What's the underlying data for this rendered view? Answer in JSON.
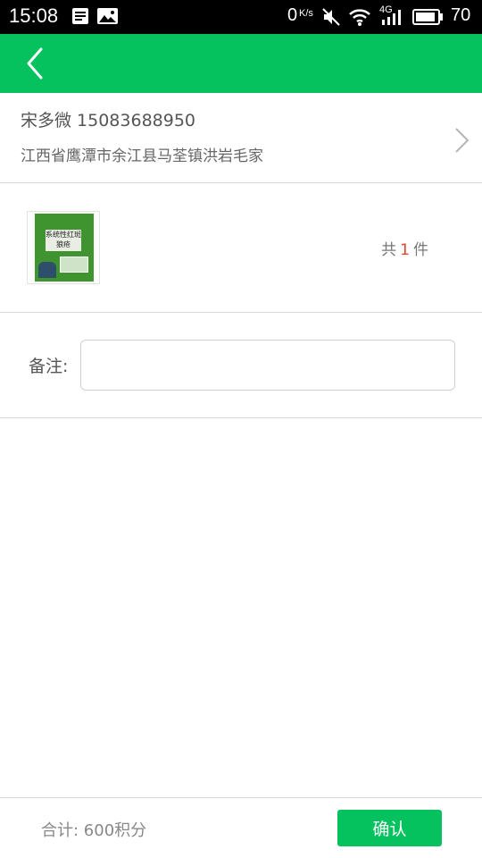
{
  "status_bar": {
    "time": "15:08",
    "net_speed": "0",
    "net_unit": "K/s",
    "network_type": "4G",
    "battery": "70",
    "icons": [
      "notification-icon",
      "gallery-icon",
      "mute-icon",
      "wifi-icon",
      "signal-icon",
      "battery-icon"
    ]
  },
  "header": {
    "back_icon": "back-arrow-icon",
    "color": "#06c25e"
  },
  "address": {
    "name_phone": "宋多微 15083688950",
    "detail": "江西省鹰潭市余江县马荃镇洪岩毛家",
    "chevron_icon": "chevron-right-icon"
  },
  "goods": {
    "book_cover_title": "系统性红斑狼疮",
    "count_prefix": "共",
    "count_value": "1",
    "count_suffix": "件"
  },
  "remark": {
    "label": "备注:",
    "value": "",
    "placeholder": ""
  },
  "footer": {
    "total": "合计: 600积分",
    "confirm_label": "确认"
  },
  "colors": {
    "accent": "#06c25e",
    "count_highlight": "#e8432d"
  }
}
